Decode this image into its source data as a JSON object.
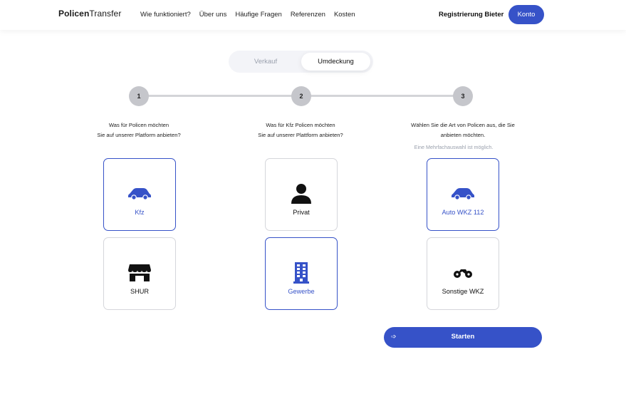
{
  "header": {
    "logo_bold": "Policen",
    "logo_regular": "Transfer",
    "nav": [
      "Wie funktioniert?",
      "Über uns",
      "Häufige Fragen",
      "Referenzen",
      "Kosten"
    ],
    "register_label": "Registrierung Bieter",
    "account_label": "Konto"
  },
  "mode_toggle": {
    "options": [
      "Verkauf",
      "Umdeckung"
    ],
    "selected": "Umdeckung"
  },
  "steps": [
    {
      "number": "1",
      "question_line1": "Was für Policen möchten",
      "question_line2": "Sie auf unserer Platform anbieten?",
      "options": [
        {
          "label": "Kfz",
          "icon": "car-icon",
          "selected": true
        },
        {
          "label": "SHUR",
          "icon": "store-icon",
          "selected": false
        }
      ]
    },
    {
      "number": "2",
      "question_line1": "Was für Kfz Policen möchten",
      "question_line2": "Sie auf unserer Plattform anbieten?",
      "options": [
        {
          "label": "Privat",
          "icon": "person-icon",
          "selected": false
        },
        {
          "label": "Gewerbe",
          "icon": "building-icon",
          "selected": true
        }
      ]
    },
    {
      "number": "3",
      "question_line1": "Wählen Sie die Art von Policen aus, die Sie",
      "question_line2": "anbieten möchten.",
      "hint": "Eine Mehrfachauswahl ist möglich.",
      "options": [
        {
          "label": "Auto WKZ 112",
          "icon": "car-icon",
          "selected": true
        },
        {
          "label": "Sonstige WKZ",
          "icon": "motorcycle-icon",
          "selected": false
        }
      ]
    }
  ],
  "start_button": {
    "label": "Starten",
    "arrow": "➩"
  },
  "colors": {
    "accent": "#3652c8",
    "muted": "#9aa0ad",
    "step_dot": "#c5c6cb"
  }
}
